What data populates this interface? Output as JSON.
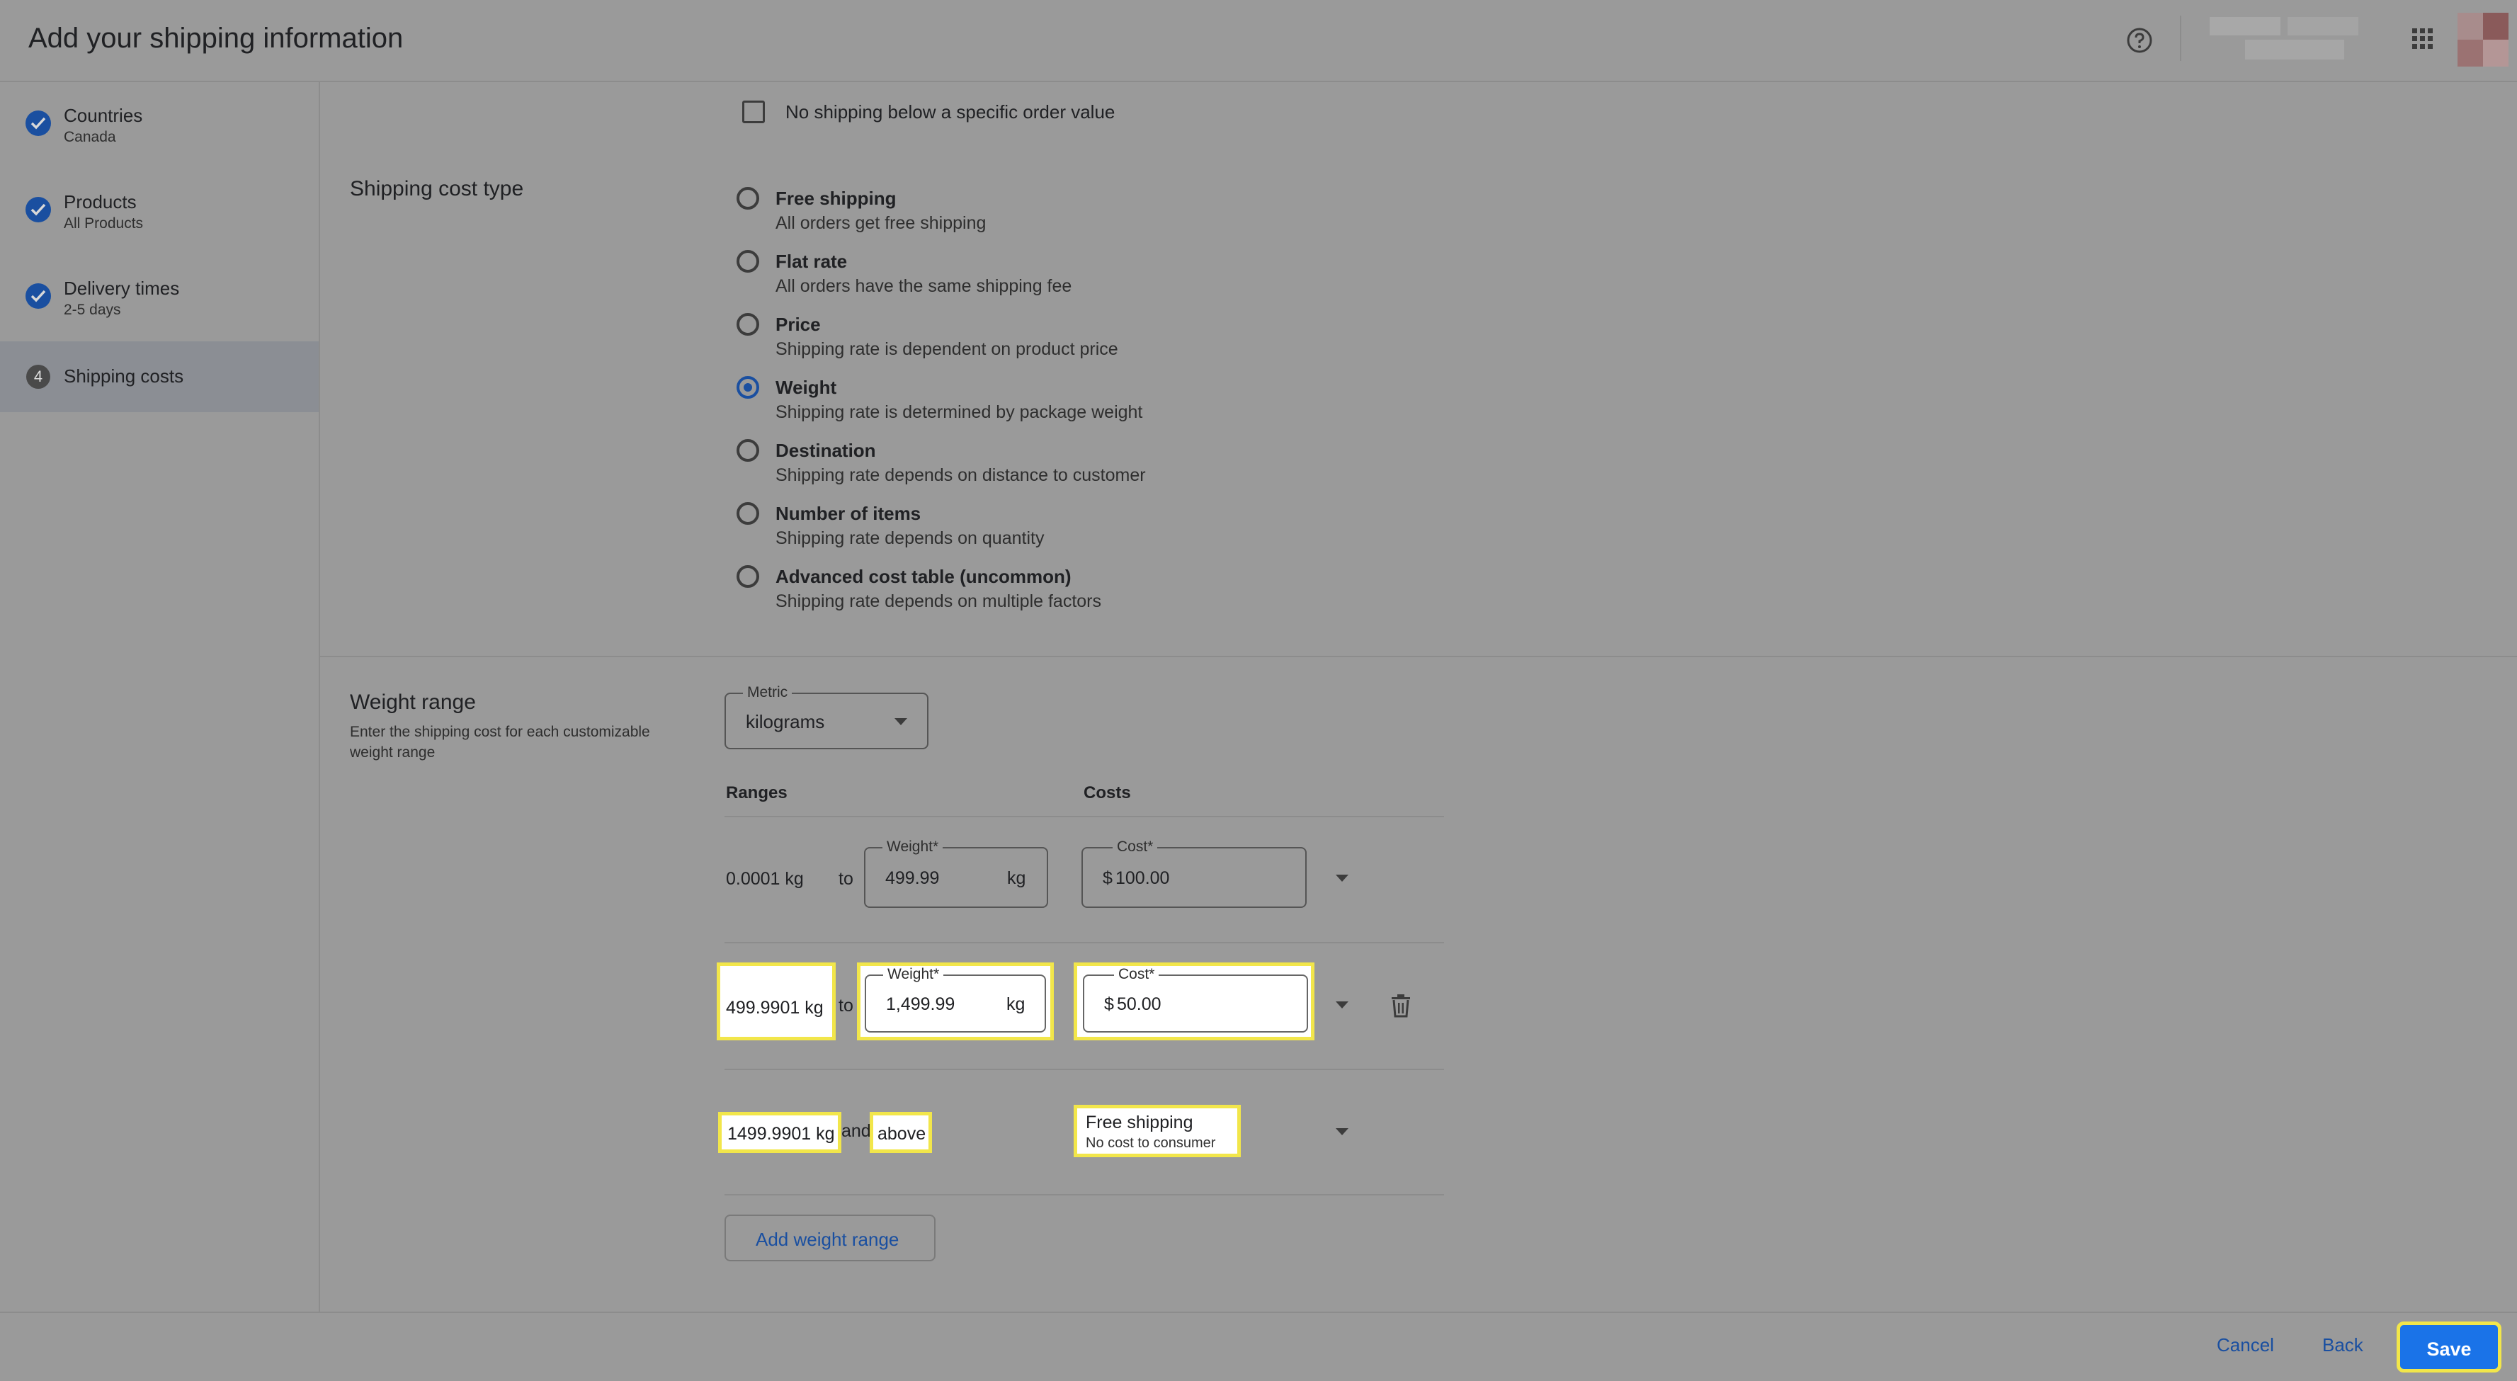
{
  "header": {
    "title": "Add your shipping information"
  },
  "sidebar": {
    "steps": [
      {
        "label": "Countries",
        "sub": "Canada"
      },
      {
        "label": "Products",
        "sub": "All Products"
      },
      {
        "label": "Delivery times",
        "sub": "2-5 days"
      },
      {
        "label": "Shipping costs",
        "number": "4"
      }
    ]
  },
  "min_order": {
    "label": "No shipping below a specific order value",
    "checked": false
  },
  "cost_type": {
    "heading": "Shipping cost type",
    "options": [
      {
        "title": "Free shipping",
        "desc": "All orders get free shipping",
        "selected": false
      },
      {
        "title": "Flat rate",
        "desc": "All orders have the same shipping fee",
        "selected": false
      },
      {
        "title": "Price",
        "desc": "Shipping rate is dependent on product price",
        "selected": false
      },
      {
        "title": "Weight",
        "desc": "Shipping rate is determined by package weight",
        "selected": true
      },
      {
        "title": "Destination",
        "desc": "Shipping rate depends on distance to customer",
        "selected": false
      },
      {
        "title": "Number of items",
        "desc": "Shipping rate depends on quantity",
        "selected": false
      },
      {
        "title": "Advanced cost table (uncommon)",
        "desc": "Shipping rate depends on multiple factors",
        "selected": false
      }
    ]
  },
  "weight_range": {
    "heading": "Weight range",
    "description_line1": "Enter the shipping cost for each customizable",
    "description_line2": "weight range",
    "metric_label": "Metric",
    "metric_value": "kilograms",
    "col_ranges": "Ranges",
    "col_costs": "Costs",
    "rows": [
      {
        "from": "0.0001 kg",
        "to_word": "to",
        "weight_label": "Weight*",
        "weight_value": "499.99",
        "unit": "kg",
        "cost_label": "Cost*",
        "currency": "$",
        "cost_value": "100.00"
      },
      {
        "from": "499.9901 kg",
        "to_word": "to",
        "weight_label": "Weight*",
        "weight_value": "1,499.99",
        "unit": "kg",
        "cost_label": "Cost*",
        "currency": "$",
        "cost_value": "50.00"
      },
      {
        "from": "1499.9901 kg",
        "and_word": "and",
        "above_word": "above",
        "cost_title": "Free shipping",
        "cost_desc": "No cost to consumer"
      }
    ],
    "add_button": "Add weight range"
  },
  "footer": {
    "cancel": "Cancel",
    "back": "Back",
    "save": "Save"
  },
  "colors": {
    "accent": "#1a73e8",
    "highlight": "#f2e64a",
    "overlay": "#9a9a9a"
  }
}
